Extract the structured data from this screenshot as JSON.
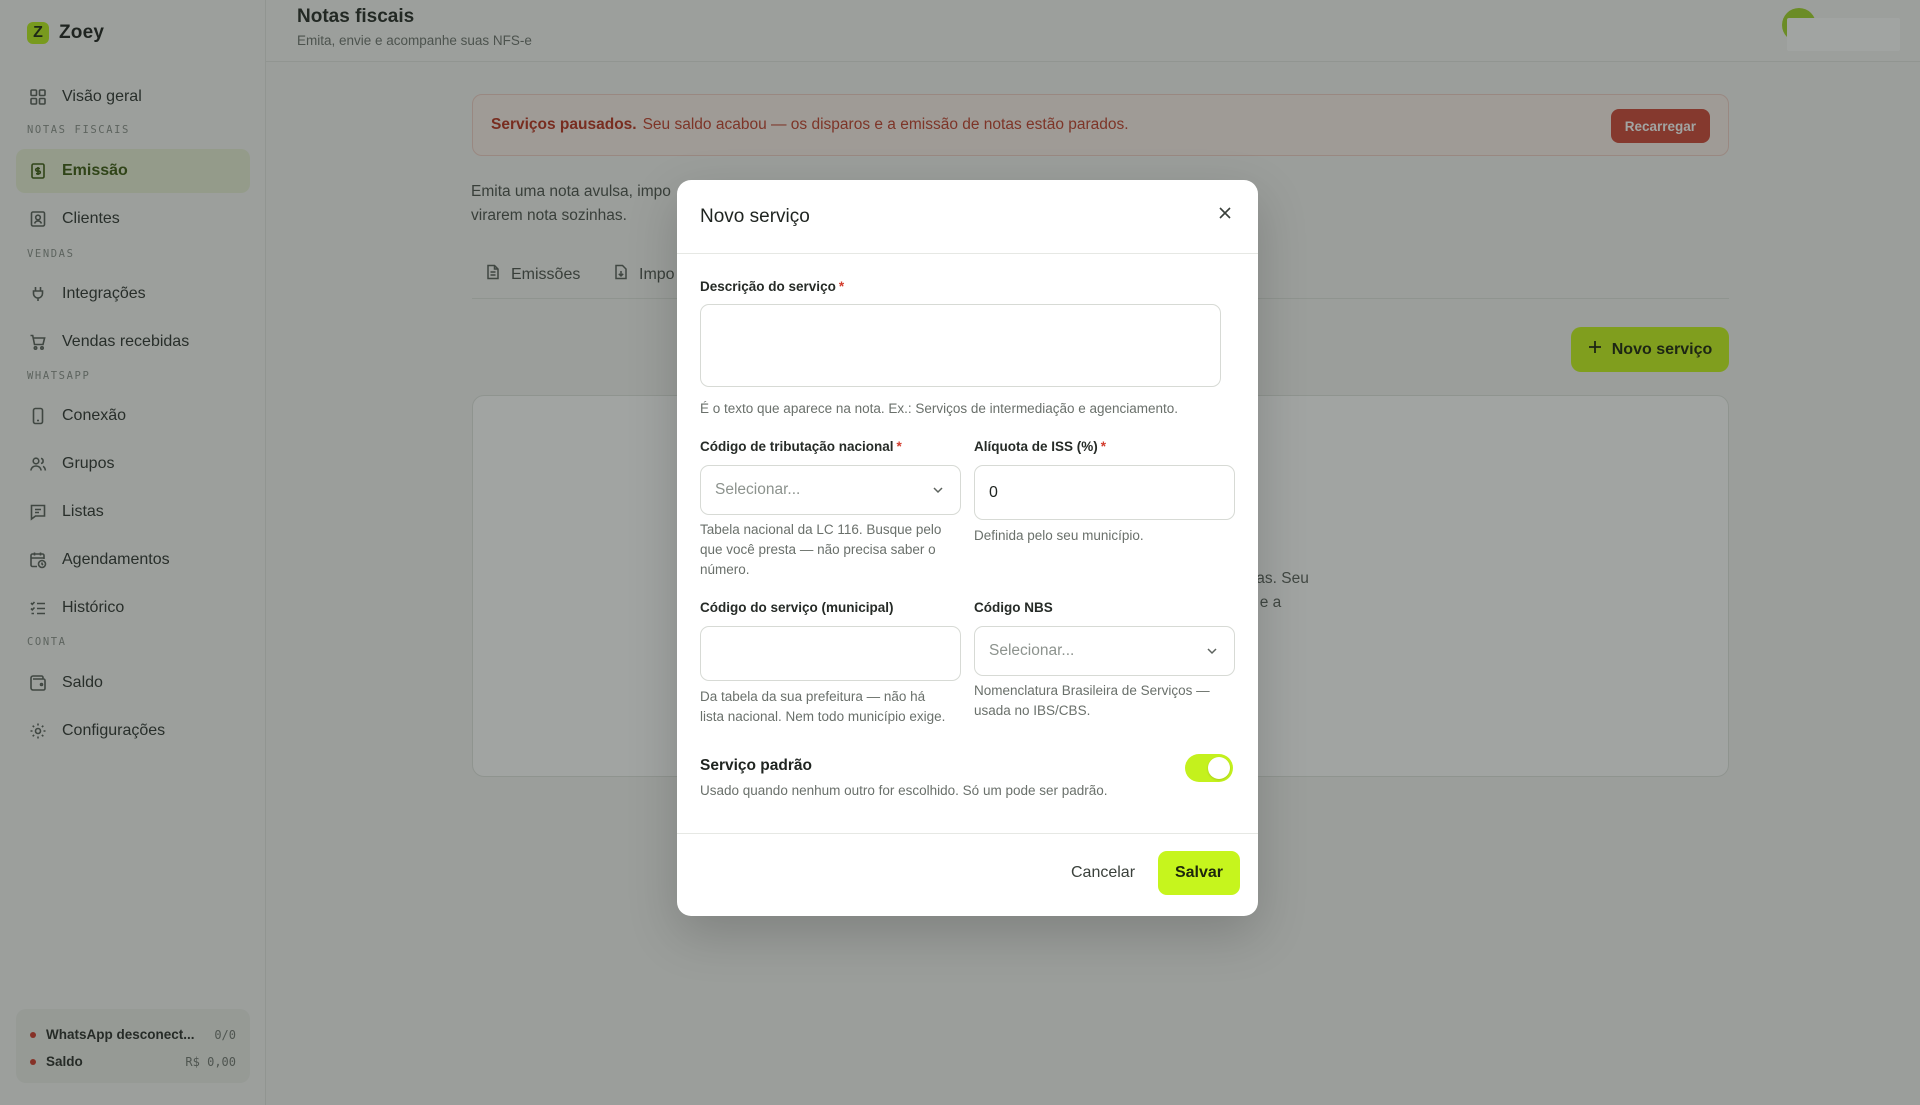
{
  "app": {
    "name": "Zoey",
    "logo_letter": "Z"
  },
  "sidebar": {
    "items": [
      {
        "label": "Visão geral",
        "icon": "grid-icon"
      },
      {
        "label": "Emissão",
        "icon": "invoice-icon",
        "active": true
      },
      {
        "label": "Clientes",
        "icon": "contact-card-icon"
      },
      {
        "label": "Integrações",
        "icon": "plug-icon"
      },
      {
        "label": "Vendas recebidas",
        "icon": "cart-icon"
      },
      {
        "label": "Conexão",
        "icon": "phone-icon"
      },
      {
        "label": "Grupos",
        "icon": "users-icon"
      },
      {
        "label": "Listas",
        "icon": "list-icon"
      },
      {
        "label": "Agendamentos",
        "icon": "calendar-clock-icon"
      },
      {
        "label": "Histórico",
        "icon": "checklist-icon"
      },
      {
        "label": "Saldo",
        "icon": "wallet-icon"
      },
      {
        "label": "Configurações",
        "icon": "gear-icon"
      }
    ],
    "sections": {
      "notas": "NOTAS FISCAIS",
      "vendas": "VENDAS",
      "whatsapp": "WHATSAPP",
      "conta": "CONTA"
    },
    "status": {
      "whatsapp_label": "WhatsApp desconect...",
      "whatsapp_value": "0/0",
      "saldo_label": "Saldo",
      "saldo_value": "R$ 0,00"
    }
  },
  "header": {
    "title": "Notas fiscais",
    "subtitle": "Emita, envie e acompanhe suas NFS-e"
  },
  "banner": {
    "strong": "Serviços pausados.",
    "text": "Seu saldo acabou — os disparos e a emissão de notas estão parados.",
    "button": "Recarregar"
  },
  "main": {
    "intro_line1": "Emita uma nota avulsa, impo",
    "intro_line2": "virarem nota sozinhas.",
    "tabs": [
      {
        "label": "Emissões",
        "icon": "document-icon"
      },
      {
        "label": "Impo",
        "icon": "import-icon"
      }
    ],
    "new_service_button": "Novo serviço",
    "card_text_line1": "tas. Seu",
    "card_text_line2": "l e a"
  },
  "modal": {
    "title": "Novo serviço",
    "descricao": {
      "label": "Descrição do serviço",
      "required_mark": "*",
      "value": "",
      "help": "É o texto que aparece na nota. Ex.: Serviços de intermediação e agenciamento."
    },
    "codigo_tributacao": {
      "label": "Código de tributação nacional",
      "required_mark": "*",
      "placeholder": "Selecionar...",
      "help_line1": "Tabela nacional da LC 116. Busque pelo",
      "help_line2": "que você presta — não precisa saber o",
      "help_line3": "número."
    },
    "aliquota": {
      "label": "Alíquota de ISS (%)",
      "required_mark": "*",
      "value": "0",
      "help": "Definida pelo seu município."
    },
    "codigo_servico": {
      "label": "Código do serviço (municipal)",
      "value": "",
      "help_line1": "Da tabela da sua prefeitura — não há",
      "help_line2": "lista nacional. Nem todo município exige."
    },
    "codigo_nbs": {
      "label": "Código NBS",
      "placeholder": "Selecionar...",
      "help_line1": "Nomenclatura Brasileira de Serviços —",
      "help_line2": "usada no IBS/CBS."
    },
    "servico_padrao": {
      "title": "Serviço padrão",
      "help": "Usado quando nenhum outro for escolhido. Só um pode ser padrão.",
      "enabled": true
    },
    "cancel_label": "Cancelar",
    "save_label": "Salvar"
  },
  "colors": {
    "accent": "#c6f51d",
    "danger": "#cf4737",
    "active_nav_bg": "#e8f0d6"
  }
}
